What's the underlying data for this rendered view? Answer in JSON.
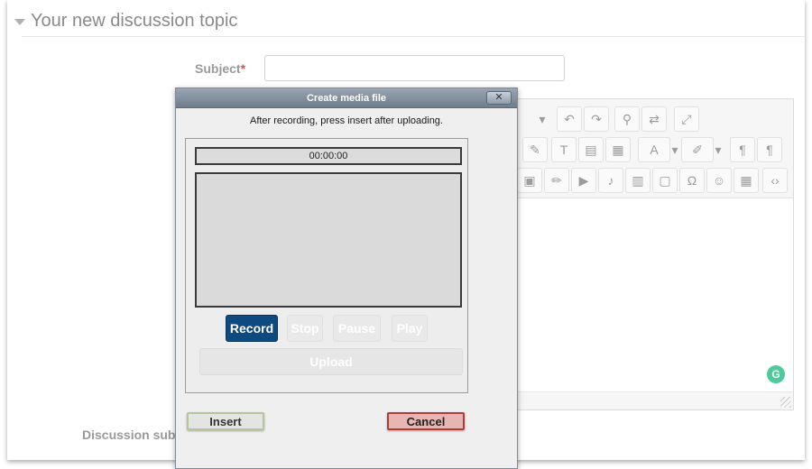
{
  "section": {
    "title": "Your new discussion topic",
    "icon": "caret-down-icon"
  },
  "form": {
    "subject_label": "Subject",
    "required_marker": "*",
    "subject_value": "",
    "subscription_label": "Discussion subs"
  },
  "editor": {
    "toolbar_icons": [
      "dropdown-icon",
      "undo-icon",
      "redo-icon",
      "find-icon",
      "replace-icon",
      "fullscreen-icon",
      "clear-format-icon",
      "remove-format-icon",
      "paste-text-icon",
      "paste-word-icon",
      "font-color-icon",
      "font-color-dropdown-icon",
      "highlight-icon",
      "highlight-dropdown-icon",
      "ltr-icon",
      "rtl-icon",
      "image-icon",
      "draw-icon",
      "video-icon",
      "audio-icon",
      "media-icon",
      "clipboard-icon",
      "omega-icon",
      "emoticon-icon",
      "table-icon",
      "html-icon"
    ]
  },
  "dialog": {
    "title": "Create media file",
    "close_label": "✕",
    "instructions": "After recording, press insert after uploading.",
    "timer": "00:00:00",
    "controls": {
      "record": "Record",
      "stop": "Stop",
      "pause": "Pause",
      "play": "Play",
      "upload": "Upload"
    },
    "insert_label": "Insert",
    "cancel_label": "Cancel"
  },
  "colors": {
    "record_button": "#0e4a7f",
    "cancel_border": "#b23b34",
    "insert_border": "#b7c59a",
    "title_bar": "#7d8a99",
    "required": "#d9534f"
  }
}
